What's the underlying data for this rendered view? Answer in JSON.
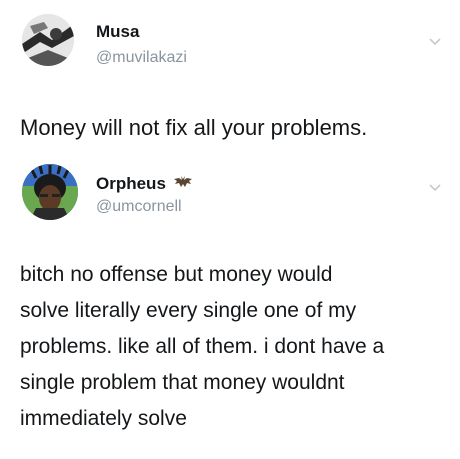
{
  "tweet1": {
    "display_name": "Musa",
    "handle": "@muvilakazi",
    "avatar_icon": "user-avatar-icon",
    "menu_icon": "chevron-down-icon",
    "text": "Money will not fix all your problems."
  },
  "tweet2": {
    "display_name": "Orpheus",
    "handle": "@umcornell",
    "avatar_icon": "user-avatar-icon",
    "name_emoji_icon": "bat-emoji-icon",
    "menu_icon": "chevron-down-icon",
    "text": "bitch no offense but money would\nsolve literally every single one of my\nproblems. like all of them. i dont have a\nsingle problem that money wouldnt\nimmediately solve"
  },
  "colors": {
    "text": "#14171a",
    "secondary_text": "#8a949e",
    "chevron": "#c4ccd3",
    "background": "#ffffff"
  }
}
